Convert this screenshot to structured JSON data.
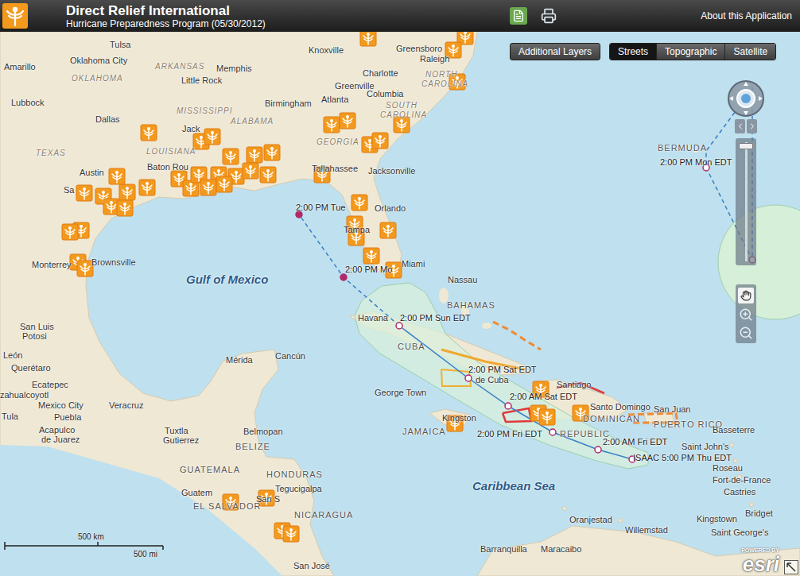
{
  "header": {
    "title": "Direct Relief International",
    "subtitle": "Hurricane Preparedness Program (05/30/2012)",
    "about": "About this Application"
  },
  "toolbar": {
    "layers_button": "Additional Layers",
    "basemaps": [
      {
        "label": "Streets",
        "selected": true
      },
      {
        "label": "Topographic",
        "selected": false
      },
      {
        "label": "Satellite",
        "selected": false
      }
    ]
  },
  "map": {
    "labels": [
      {
        "text": "Amarillo",
        "kind": "city"
      },
      {
        "text": "Oklahoma City",
        "kind": "city"
      },
      {
        "text": "Tulsa",
        "kind": "city"
      },
      {
        "text": "OKLAHOMA",
        "kind": "state"
      },
      {
        "text": "ARKANSAS",
        "kind": "state"
      },
      {
        "text": "Memphis",
        "kind": "city"
      },
      {
        "text": "Knoxville",
        "kind": "city"
      },
      {
        "text": "Greensboro",
        "kind": "city"
      },
      {
        "text": "Raleigh",
        "kind": "city"
      },
      {
        "text": "Little Rock",
        "kind": "city"
      },
      {
        "text": "Charlotte",
        "kind": "city"
      },
      {
        "text": "NORTH",
        "kind": "state"
      },
      {
        "text": "CAROLINA",
        "kind": "state"
      },
      {
        "text": "Greenville",
        "kind": "city"
      },
      {
        "text": "Columbia",
        "kind": "city"
      },
      {
        "text": "SOUTH",
        "kind": "state"
      },
      {
        "text": "CAROLINA",
        "kind": "state"
      },
      {
        "text": "Lubbock",
        "kind": "city"
      },
      {
        "text": "MISSISSIPPI",
        "kind": "state"
      },
      {
        "text": "Birmingham",
        "kind": "city"
      },
      {
        "text": "Atlanta",
        "kind": "city"
      },
      {
        "text": "Dallas",
        "kind": "city"
      },
      {
        "text": "ALABAMA",
        "kind": "state"
      },
      {
        "text": "GEORGIA",
        "kind": "state"
      },
      {
        "text": "Jack",
        "kind": "city"
      },
      {
        "text": "TEXAS",
        "kind": "state"
      },
      {
        "text": "LOUISIANA",
        "kind": "state"
      },
      {
        "text": "Austin",
        "kind": "city"
      },
      {
        "text": "Baton Rou",
        "kind": "city"
      },
      {
        "text": "Tallahassee",
        "kind": "city"
      },
      {
        "text": "Jacksonville",
        "kind": "city"
      },
      {
        "text": "Sa",
        "kind": "city"
      },
      {
        "text": "Orlando",
        "kind": "city"
      },
      {
        "text": "Tampa",
        "kind": "city"
      },
      {
        "text": "Miami",
        "kind": "city"
      },
      {
        "text": "Nassau",
        "kind": "city"
      },
      {
        "text": "Monterrey",
        "kind": "city"
      },
      {
        "text": "Brownsville",
        "kind": "city"
      },
      {
        "text": "Gulf of Mexico",
        "kind": "water"
      },
      {
        "text": "BAHAMAS",
        "kind": "country"
      },
      {
        "text": "San Luis",
        "kind": "city"
      },
      {
        "text": "Potosi",
        "kind": "city"
      },
      {
        "text": "Havana",
        "kind": "city"
      },
      {
        "text": "CUBA",
        "kind": "country"
      },
      {
        "text": "León",
        "kind": "city"
      },
      {
        "text": "Cancún",
        "kind": "city"
      },
      {
        "text": "Mérida",
        "kind": "city"
      },
      {
        "text": "Querétaro",
        "kind": "city"
      },
      {
        "text": "de Cuba",
        "kind": "city"
      },
      {
        "text": "Santiago",
        "kind": "city"
      },
      {
        "text": "Ecatepec",
        "kind": "city"
      },
      {
        "text": "zahualcoyotl",
        "kind": "city"
      },
      {
        "text": "Mexico City",
        "kind": "city"
      },
      {
        "text": "Tula",
        "kind": "city"
      },
      {
        "text": "Puebla",
        "kind": "city"
      },
      {
        "text": "George Town",
        "kind": "city"
      },
      {
        "text": "Veracruz",
        "kind": "city"
      },
      {
        "text": "Tuxtla",
        "kind": "city"
      },
      {
        "text": "Gutierrez",
        "kind": "city"
      },
      {
        "text": "Belmopan",
        "kind": "city"
      },
      {
        "text": "Santo Domingo",
        "kind": "city"
      },
      {
        "text": "San Juan",
        "kind": "city"
      },
      {
        "text": "Kingston",
        "kind": "city"
      },
      {
        "text": "JAMAICA",
        "kind": "country"
      },
      {
        "text": "Acapulco",
        "kind": "city"
      },
      {
        "text": "de Juarez",
        "kind": "city"
      },
      {
        "text": "BELIZE",
        "kind": "country"
      },
      {
        "text": "PUERTO RICO",
        "kind": "country"
      },
      {
        "text": "DOMINICAN",
        "kind": "country"
      },
      {
        "text": "REPUBLIC",
        "kind": "country"
      },
      {
        "text": "Basseterre",
        "kind": "city"
      },
      {
        "text": "Saint John's",
        "kind": "city"
      },
      {
        "text": "GUATEMALA",
        "kind": "country"
      },
      {
        "text": "HONDURAS",
        "kind": "country"
      },
      {
        "text": "Tegucigalpa",
        "kind": "city"
      },
      {
        "text": "Guatem",
        "kind": "city"
      },
      {
        "text": "San S",
        "kind": "city"
      },
      {
        "text": "EL SALVADOR",
        "kind": "country"
      },
      {
        "text": "NICARAGUA",
        "kind": "country"
      },
      {
        "text": "Caribbean Sea",
        "kind": "water"
      },
      {
        "text": "Roseau",
        "kind": "city"
      },
      {
        "text": "Fort-de-France",
        "kind": "city"
      },
      {
        "text": "Castries",
        "kind": "city"
      },
      {
        "text": "Bridget",
        "kind": "city"
      },
      {
        "text": "Kingstown",
        "kind": "city"
      },
      {
        "text": "Saint George's",
        "kind": "city"
      },
      {
        "text": "Oranjestad",
        "kind": "city"
      },
      {
        "text": "Willemstad",
        "kind": "city"
      },
      {
        "text": "Barranquilla",
        "kind": "city"
      },
      {
        "text": "Maracaibo",
        "kind": "city"
      },
      {
        "text": "San José",
        "kind": "city"
      },
      {
        "text": "BERMUDA",
        "kind": "country"
      }
    ],
    "storm_labels": [
      "2:00 PM Tue",
      "2:00 PM Mo",
      "2:00 PM Sun EDT",
      "2:00 PM Sat EDT",
      "2:00 AM Sat EDT",
      "2:00 PM Fri EDT",
      "2:00 AM Fri EDT",
      "ISAAC 5:00 PM Thu EDT",
      "2:00 PM Mon EDT"
    ]
  },
  "scale_bar": {
    "metric": "500 km",
    "imperial": "500 mi"
  },
  "attribution": {
    "powered_by": "POWERED BY",
    "brand": "esri"
  }
}
